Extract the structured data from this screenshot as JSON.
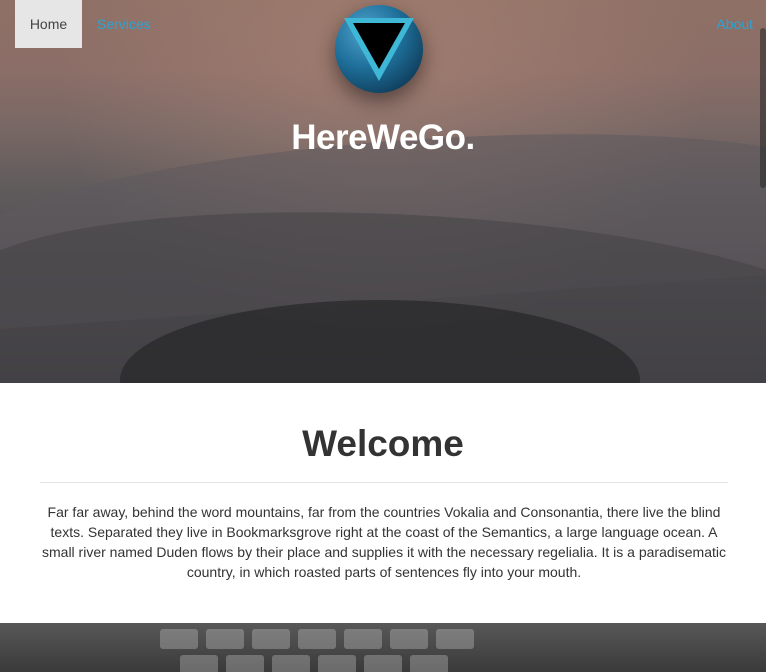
{
  "nav": {
    "home_label": "Home",
    "services_label": "Services",
    "about_label": "About"
  },
  "hero": {
    "title": "HereWeGo."
  },
  "welcome": {
    "heading": "Welcome",
    "body": "Far far away, behind the word mountains, far from the countries Vokalia and Consonantia, there live the blind texts. Separated they live in Bookmarksgrove right at the coast of the Semantics, a large language ocean. A small river named Duden flows by their place and supplies it with the necessary regelialia. It is a paradisematic country, in which roasted parts of sentences fly into your mouth."
  },
  "icons": {
    "logo": "inverted-triangle-logo-icon"
  },
  "colors": {
    "link": "#2aa4d6",
    "active_nav_bg": "#e6e6e6",
    "logo_ring": "#3aa8c9",
    "logo_sphere": "#1e6f9a"
  }
}
